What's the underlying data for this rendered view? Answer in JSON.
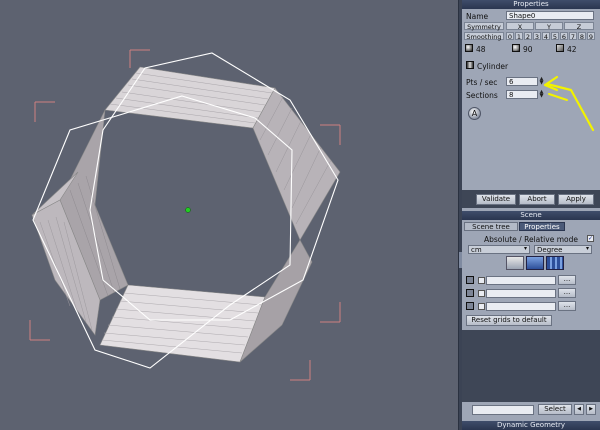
{
  "properties_panel": {
    "title": "Properties",
    "name_label": "Name",
    "name_value": "Shape0",
    "symmetry_label": "Symmetry",
    "axes": [
      "X",
      "Y",
      "Z"
    ],
    "smoothing_label": "Smoothing",
    "smoothing_values": [
      "0",
      "1",
      "2",
      "3",
      "4",
      "5",
      "6",
      "7",
      "8",
      "9"
    ],
    "counts": [
      "48",
      "90",
      "42"
    ],
    "shape_type": "Cylinder",
    "pts_label": "Pts / sec",
    "pts_value": "6",
    "sections_label": "Sections",
    "sections_value": "8",
    "buttons": {
      "validate": "Validate",
      "abort": "Abort",
      "apply": "Apply"
    }
  },
  "scene_panel": {
    "title": "Scene",
    "tabs": [
      "Scene tree",
      "Properties"
    ],
    "mode_label": "Absolute / Relative mode",
    "mode_checked": true,
    "unit_select": "cm",
    "angle_select": "Degree",
    "reset_label": "Reset grids to default",
    "browse_label": "...",
    "select_label": "Select"
  },
  "bottom_panel": {
    "title": "Dynamic Geometry"
  },
  "colors": {
    "annotation_arrow": "#f2f200",
    "titlebar": "#2b3650",
    "panel_bg": "#9ea6b6",
    "viewport_bg": "#5d6270"
  },
  "icons": [
    "sphere-icon",
    "cylinder-icon",
    "object-icon",
    "cursor-icon",
    "link-icon",
    "grid-icon",
    "axis-icon"
  ]
}
